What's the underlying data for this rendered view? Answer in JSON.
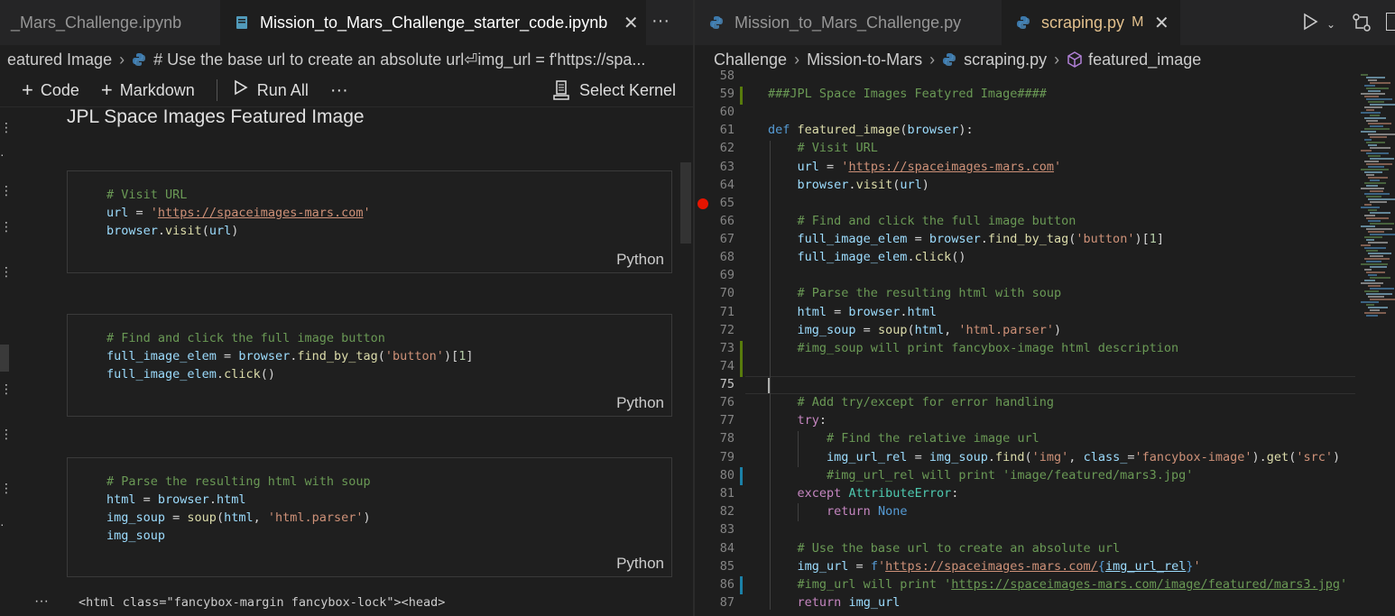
{
  "left_tabs": [
    {
      "label": "_Mars_Challenge.ipynb",
      "active": false
    },
    {
      "label": "Mission_to_Mars_Challenge_starter_code.ipynb",
      "active": true
    }
  ],
  "right_tabs": [
    {
      "label": "Mission_to_Mars_Challenge.py",
      "active": false
    },
    {
      "label": "scraping.py",
      "active": true,
      "badge": "M"
    }
  ],
  "left_breadcrumb": [
    "eatured Image",
    "# Use the base url to create an absolute url⏎img_url = f'https://spa..."
  ],
  "right_breadcrumb": [
    "Challenge",
    "Mission-to-Mars",
    "scraping.py",
    "featured_image"
  ],
  "toolbar": {
    "code": "Code",
    "markdown": "Markdown",
    "run_all": "Run All",
    "more": "···",
    "select_kernel": "Select Kernel"
  },
  "notebook": {
    "heading": "JPL Space Images Featured Image",
    "cells": [
      {
        "lang": "Python"
      },
      {
        "lang": "Python"
      },
      {
        "lang": "Python"
      }
    ],
    "output_ellipsis": "···",
    "output_text": "<html class=\"fancybox-margin fancybox-lock\"><head>"
  },
  "editor": {
    "line_numbers": [
      "58",
      "59",
      "60",
      "61",
      "62",
      "63",
      "64",
      "65",
      "66",
      "67",
      "68",
      "69",
      "70",
      "71",
      "72",
      "73",
      "74",
      "75",
      "76",
      "77",
      "78",
      "79",
      "80",
      "81",
      "82",
      "83",
      "84",
      "85",
      "86",
      "87"
    ],
    "breakpoint_line": "65",
    "current_line": "75"
  },
  "colors": {
    "accent_modified": "#e2c08d",
    "breakpoint": "#e51400",
    "gutter_added": "#587c0c",
    "gutter_modified": "#1b81a8"
  }
}
